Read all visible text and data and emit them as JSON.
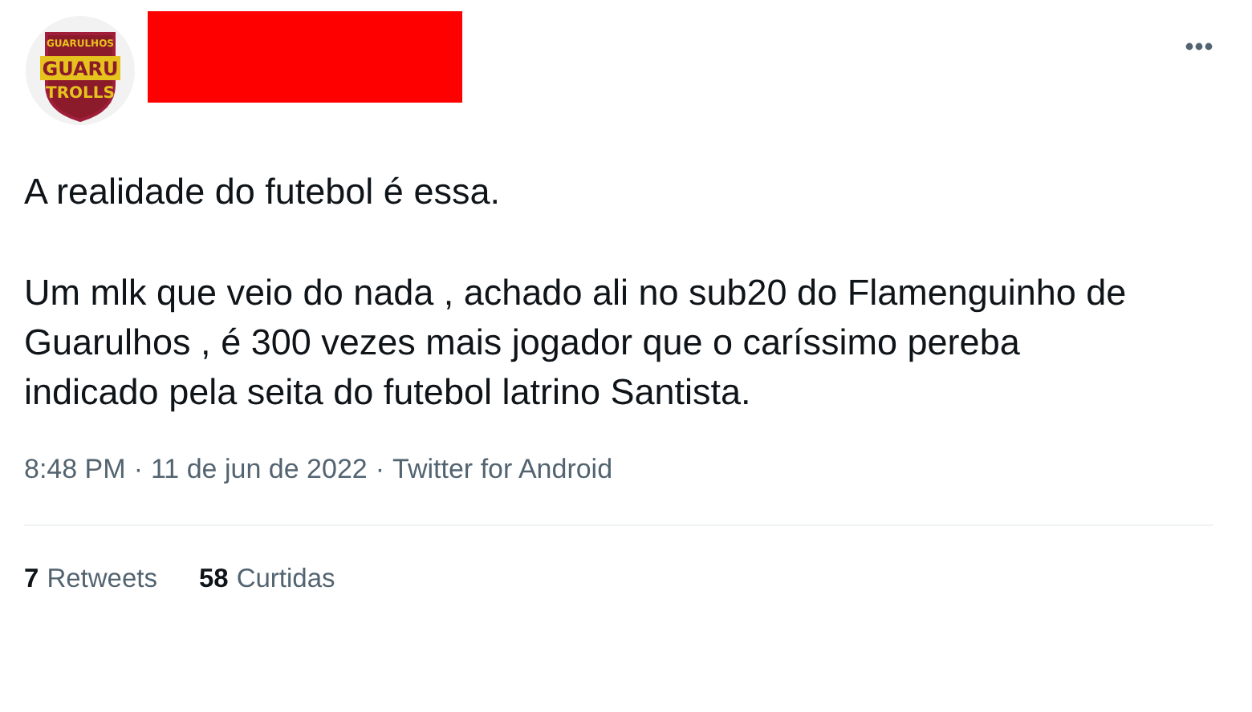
{
  "avatar": {
    "line_1": "GUARULHOS",
    "line_2": "GUARU",
    "line_3": "TROLLS"
  },
  "tweet": {
    "paragraphs": [
      "A realidade do futebol é essa.",
      "Um mlk que veio do nada , achado ali no sub20 do Flamenguinho de Guarulhos , é 300 vezes mais jogador que o caríssimo pereba indicado pela seita do futebol latrino Santista."
    ],
    "separator": "·",
    "time": "8:48 PM",
    "date": "11 de jun de 2022",
    "source": "Twitter for Android"
  },
  "stats": [
    {
      "count": "7",
      "label": "Retweets"
    },
    {
      "count": "58",
      "label": "Curtidas"
    }
  ]
}
